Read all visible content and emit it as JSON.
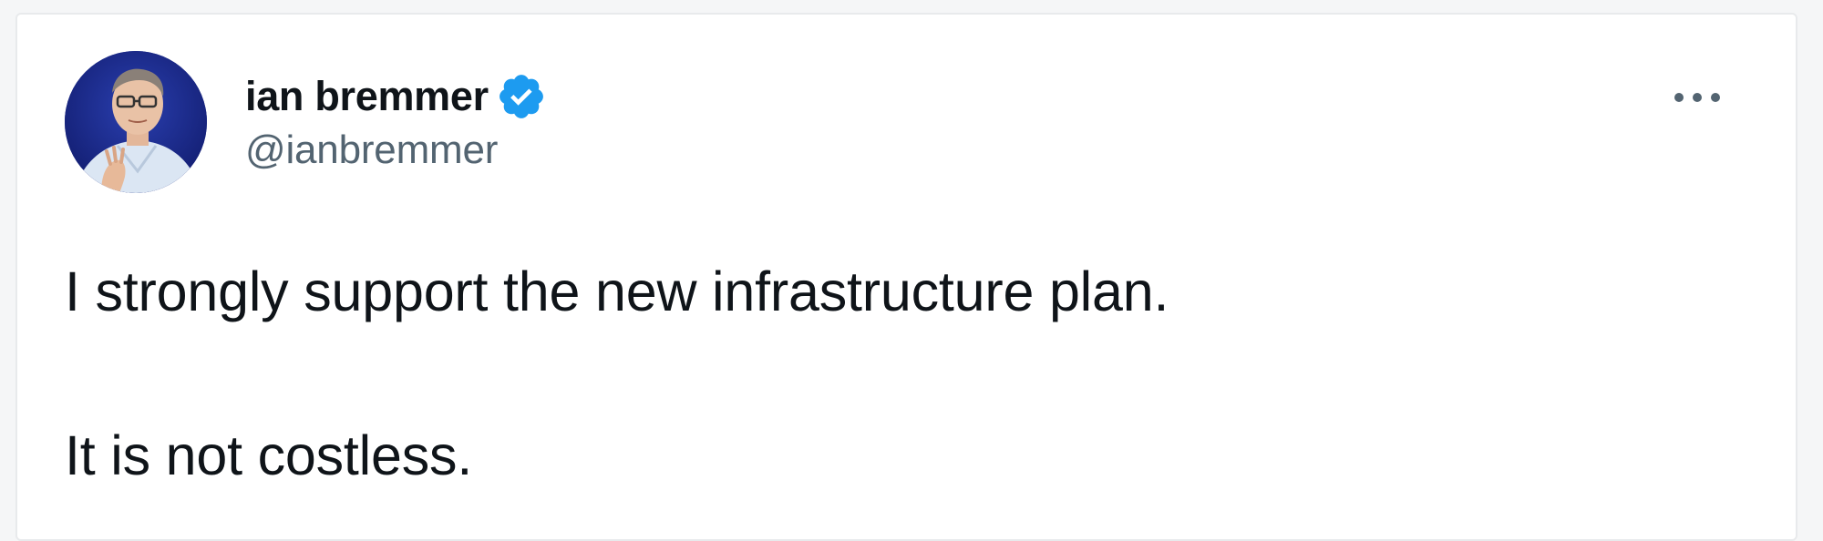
{
  "tweet": {
    "author": {
      "display_name": "ian bremmer",
      "handle": "@ianbremmer",
      "verified": true,
      "avatar_icon": "person-photo-avatar"
    },
    "text_lines": [
      "I strongly support the new infrastructure plan.",
      "It is not costless."
    ],
    "more_menu_icon": "more-horizontal-icon"
  },
  "colors": {
    "verified_blue": "#1d9bf0",
    "text_primary": "#0f1419",
    "text_secondary": "#536471",
    "card_border": "#e8eaec"
  }
}
